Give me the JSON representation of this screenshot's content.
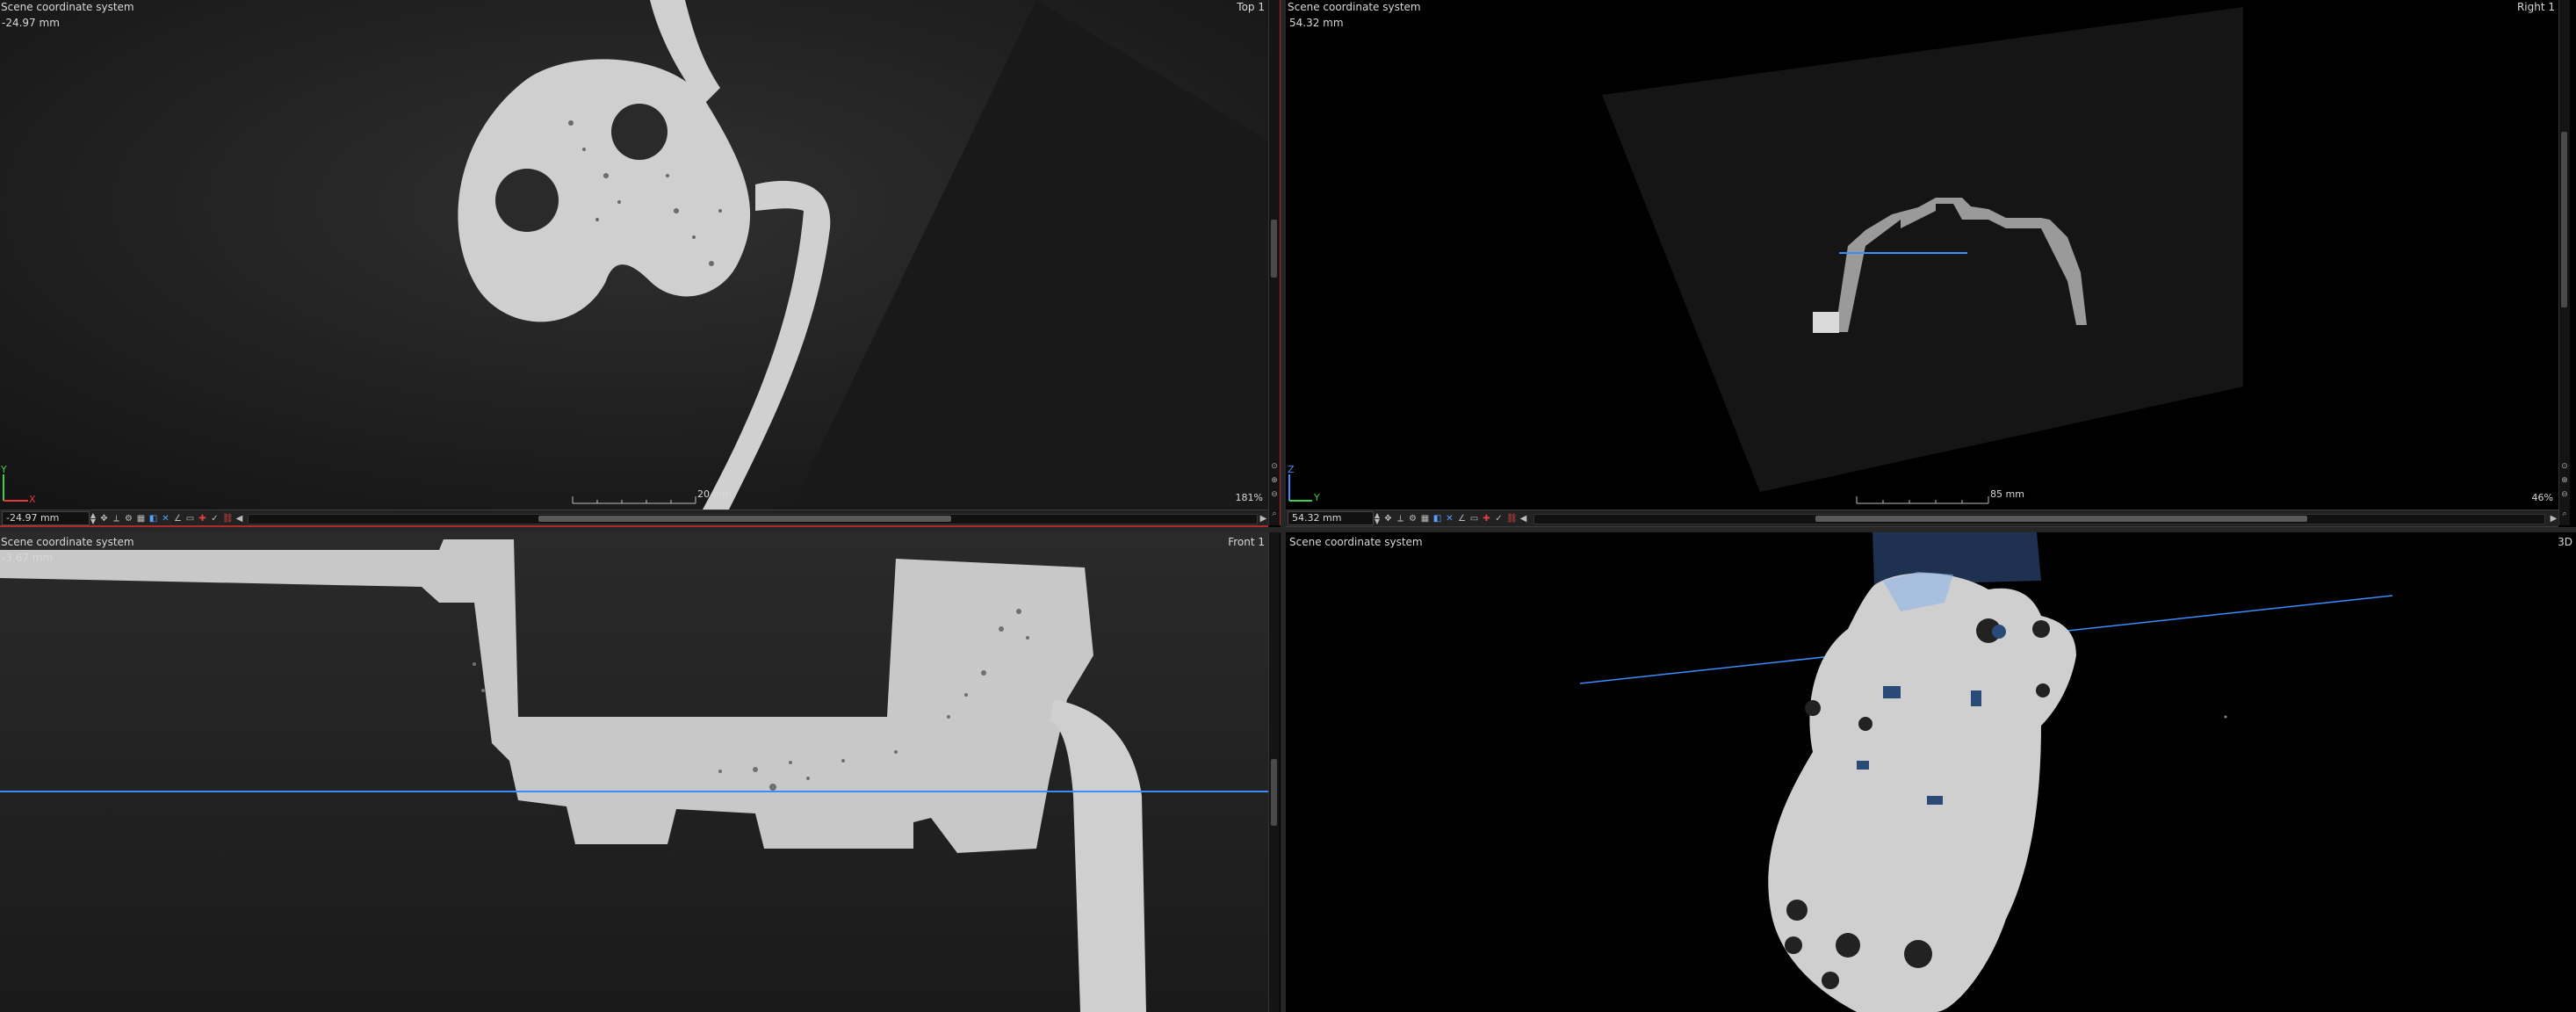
{
  "viewports": {
    "top": {
      "title": "Top 1",
      "coord_system": "Scene coordinate system",
      "position_readout": "-24.97 mm",
      "scale_label": "20 mm",
      "zoom": "181%",
      "field_value": "-24.97 mm",
      "axis_y": "Y",
      "axis_x": "X"
    },
    "right": {
      "title": "Right 1",
      "coord_system": "Scene coordinate system",
      "position_readout": "54.32 mm",
      "scale_label": "85 mm",
      "zoom": "46%",
      "field_value": "54.32 mm",
      "axis_z": "Z",
      "axis_y": "Y"
    },
    "front": {
      "title": "Front 1",
      "coord_system": "Scene coordinate system",
      "position_readout": "-3.67 mm"
    },
    "view3d": {
      "title": "3D",
      "coord_system": "Scene coordinate system"
    }
  },
  "colors": {
    "accent_blue": "#3a8cff",
    "active_border": "#b02a2a",
    "part_gray": "#d4d4d4"
  },
  "icons": [
    "zoom-icon",
    "pan-icon",
    "measure-icon",
    "clip-icon",
    "crosshair-icon"
  ]
}
